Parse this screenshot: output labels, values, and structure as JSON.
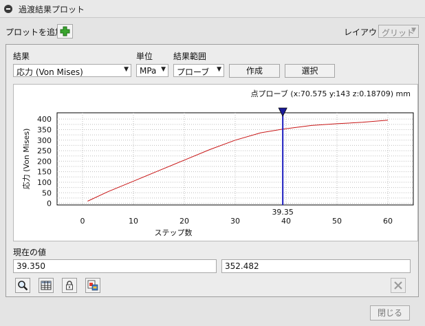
{
  "window": {
    "title": "過渡結果プロット"
  },
  "toolbar": {
    "add_plot_label": "プロットを追加",
    "layout_label": "レイアウト",
    "layout_value": "グリッド"
  },
  "controls": {
    "result_label": "結果",
    "result_value": "応力 (Von Mises)",
    "unit_label": "単位",
    "unit_value": "MPa",
    "range_label": "結果範囲",
    "range_value": "プローブ",
    "create_button": "作成",
    "select_button": "選択"
  },
  "chart_data": {
    "type": "line",
    "probe_label": "点プローブ (x:70.575 y:143 z:0.18709) mm",
    "xlabel": "ステップ数",
    "ylabel": "応力 (Von Mises)",
    "xlim": [
      -5,
      65
    ],
    "ylim": [
      -8,
      430
    ],
    "x_ticks": [
      0,
      10,
      20,
      30,
      40,
      50,
      60
    ],
    "y_ticks": [
      0,
      25,
      50,
      75,
      100,
      125,
      150,
      175,
      200,
      225,
      250,
      275,
      300,
      325,
      350,
      375,
      400
    ],
    "y_tick_labels": [
      {
        "v": 0,
        "t": "0"
      },
      {
        "v": 50,
        "t": "50"
      },
      {
        "v": 100,
        "t": "100"
      },
      {
        "v": 150,
        "t": "150"
      },
      {
        "v": 200,
        "t": "200"
      },
      {
        "v": 250,
        "t": "250"
      },
      {
        "v": 300,
        "t": "300"
      },
      {
        "v": 350,
        "t": "350"
      },
      {
        "v": 400,
        "t": "400"
      }
    ],
    "cursor_x": 39.35,
    "cursor_label": "39.35",
    "grid": true,
    "series": [
      {
        "color": "#c81414",
        "x": [
          1,
          5,
          10,
          15,
          20,
          25,
          30,
          35,
          39.35,
          45,
          50,
          55,
          60
        ],
        "y": [
          10,
          55,
          105,
          155,
          205,
          255,
          300,
          335,
          352.482,
          370,
          378,
          385,
          395
        ]
      }
    ]
  },
  "current": {
    "label": "現在の値",
    "x_value": "39.350",
    "y_value": "352.482"
  },
  "tools": {
    "zoom": "zoom-icon",
    "table": "table-icon",
    "lock": "lock-icon",
    "export": "export-icon",
    "delete": "delete-icon"
  },
  "footer": {
    "close_button": "閉じる"
  }
}
